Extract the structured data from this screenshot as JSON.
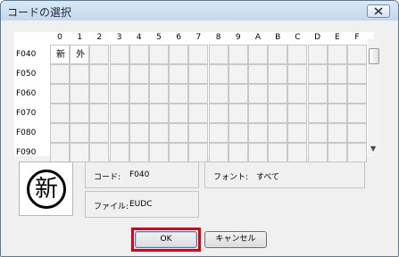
{
  "window": {
    "title": "コードの選択"
  },
  "grid": {
    "columns": [
      "0",
      "1",
      "2",
      "3",
      "4",
      "5",
      "6",
      "7",
      "8",
      "9",
      "A",
      "B",
      "C",
      "D",
      "E",
      "F"
    ],
    "rows": [
      "F040",
      "F050",
      "F060",
      "F070",
      "F080",
      "F090"
    ],
    "glyphs": [
      "新",
      "外"
    ]
  },
  "preview": {
    "glyph": "新"
  },
  "info": {
    "code_label": "コード:",
    "code_value": "F040",
    "font_label": "フォント:",
    "font_value": "すべて",
    "file_label": "ファイル:",
    "file_value": "EUDC"
  },
  "buttons": {
    "ok": "OK",
    "cancel": "キャンセル"
  },
  "colors": {
    "highlight": "#e00012"
  }
}
